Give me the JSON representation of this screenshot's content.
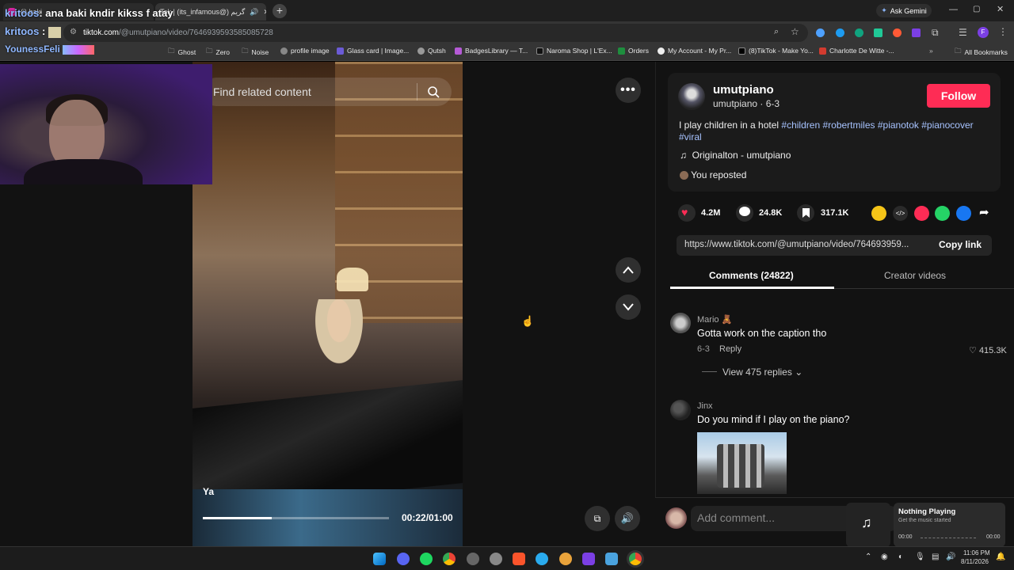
{
  "browser": {
    "tabs": [
      {
        "label": "(i) baki"
      },
      {
        "label": "Tok | (its_infamous@) گريم"
      }
    ],
    "ask_gemini": "Ask Gemini",
    "url_host": "tiktok.com",
    "url_path": "/@umutpiano/video/7646939593585085728",
    "bookmarks": [
      {
        "label": "Ghost",
        "icon": "folder-icon"
      },
      {
        "label": "Zero",
        "icon": "folder-icon"
      },
      {
        "label": "Noise",
        "icon": "folder-icon"
      },
      {
        "label": "profile image",
        "icon": "globe-icon"
      },
      {
        "label": "Glass card | Image...",
        "icon": "image-icon"
      },
      {
        "label": "Qutsh",
        "icon": "globe-icon"
      },
      {
        "label": "BadgesLibrary — T...",
        "icon": "badge-icon"
      },
      {
        "label": "Naroma Shop | L'Ex...",
        "icon": "shop-icon"
      },
      {
        "label": "Orders",
        "icon": "orders-icon"
      },
      {
        "label": "My Account - My Pr...",
        "icon": "account-icon"
      },
      {
        "label": "(8)TikTok - Make Yo...",
        "icon": "tiktok-icon"
      },
      {
        "label": "Charlotte De Witte -...",
        "icon": "music-icon"
      }
    ],
    "all_bookmarks": "All Bookmarks"
  },
  "chat_overlay": {
    "line1_user": "kritoos",
    "line1_text": ": ana baki kndir kikss f atay",
    "line2_user": "kritoos",
    "line2_sep": ":",
    "line3_user": "YounessFeli"
  },
  "video": {
    "search_placeholder": "Find related content",
    "caption_overlay": "Ya",
    "time": "00:22/01:00",
    "progress": 0.37
  },
  "author": {
    "name": "umutpiano",
    "handle_date": "umutpiano · 6-3",
    "follow": "Follow"
  },
  "description": {
    "text": "I play children in a hotel",
    "hashtags": [
      "#children",
      "#robertmiles",
      "#pianotok",
      "#pianocover",
      "#viral"
    ]
  },
  "music": "Originalton - umutpiano",
  "reposted": "You reposted",
  "stats": {
    "likes": "4.2M",
    "comments": "24.8K",
    "saves": "317.1K"
  },
  "link": {
    "url": "https://www.tiktok.com/@umutpiano/video/764693959...",
    "copy": "Copy link"
  },
  "tabs": {
    "comments": "Comments (24822)",
    "creator": "Creator videos"
  },
  "comments": [
    {
      "user": "Mario",
      "text": "Gotta work on the caption tho",
      "date": "6-3",
      "reply": "Reply",
      "likes": "415.3K",
      "view_replies": "View 475 replies"
    },
    {
      "user": "Jinx",
      "text": "Do you mind if I play on the piano?"
    }
  ],
  "comment_input": {
    "placeholder": "Add comment..."
  },
  "now_playing": {
    "title": "Nothing Playing",
    "subtitle": "Get the music started",
    "start": "00:00",
    "end": "00:00"
  },
  "clock": {
    "time": "11:06 PM",
    "date": "8/11/2026"
  },
  "colors": {
    "accent": "#fe2c55",
    "hashtag": "#a7c3ff",
    "like": "#fe2c55"
  }
}
